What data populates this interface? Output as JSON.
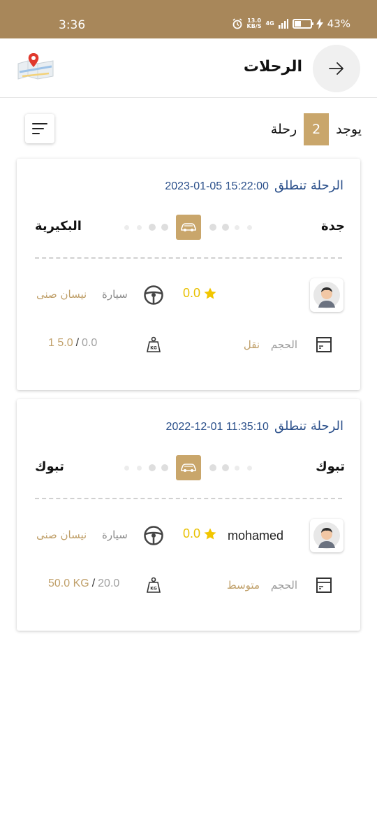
{
  "status_bar": {
    "time": "3:36",
    "net_speed_value": "13.0",
    "net_speed_unit": "KB/S",
    "network": "4G",
    "battery": "43%",
    "battery_level": 0.43,
    "icons": [
      "alarm-icon",
      "signal-icon",
      "battery-icon",
      "charging-icon"
    ]
  },
  "header": {
    "title": "الرحلات",
    "back_icon": "arrow-right-icon",
    "map_icon": "map-pin-icon"
  },
  "summary": {
    "prefix": "يوجد",
    "count": "2",
    "suffix": "رحلة",
    "filter_icon": "sort-lines-icon"
  },
  "trips": [
    {
      "start_label": "الرحلة تنطلق",
      "start_datetime": "2023-01-05 15:22:00",
      "from_city": "جدة",
      "to_city": "البكيرية",
      "driver_name": "",
      "rating": "0.0",
      "vehicle_label": "سيارة",
      "vehicle_value": "نيسان صنى",
      "size_label": "الحجم",
      "size_value": "نقل",
      "weight_used": "0.0",
      "weight_separator": "/",
      "weight_capacity": "1 5.0"
    },
    {
      "start_label": "الرحلة تنطلق",
      "start_datetime": "2022-12-01 11:35:10",
      "from_city": "تبوك",
      "to_city": "تبوك",
      "driver_name": "mohamed",
      "rating": "0.0",
      "vehicle_label": "سيارة",
      "vehicle_value": "نيسان صنى",
      "size_label": "الحجم",
      "size_value": "متوسط",
      "weight_used": "20.0",
      "weight_separator": "/",
      "weight_capacity": "50.0 KG"
    }
  ],
  "colors": {
    "accent": "#a8875a",
    "badge": "#c9a66b",
    "date_text": "#2a4f8a",
    "rating_star": "#f2c600"
  }
}
